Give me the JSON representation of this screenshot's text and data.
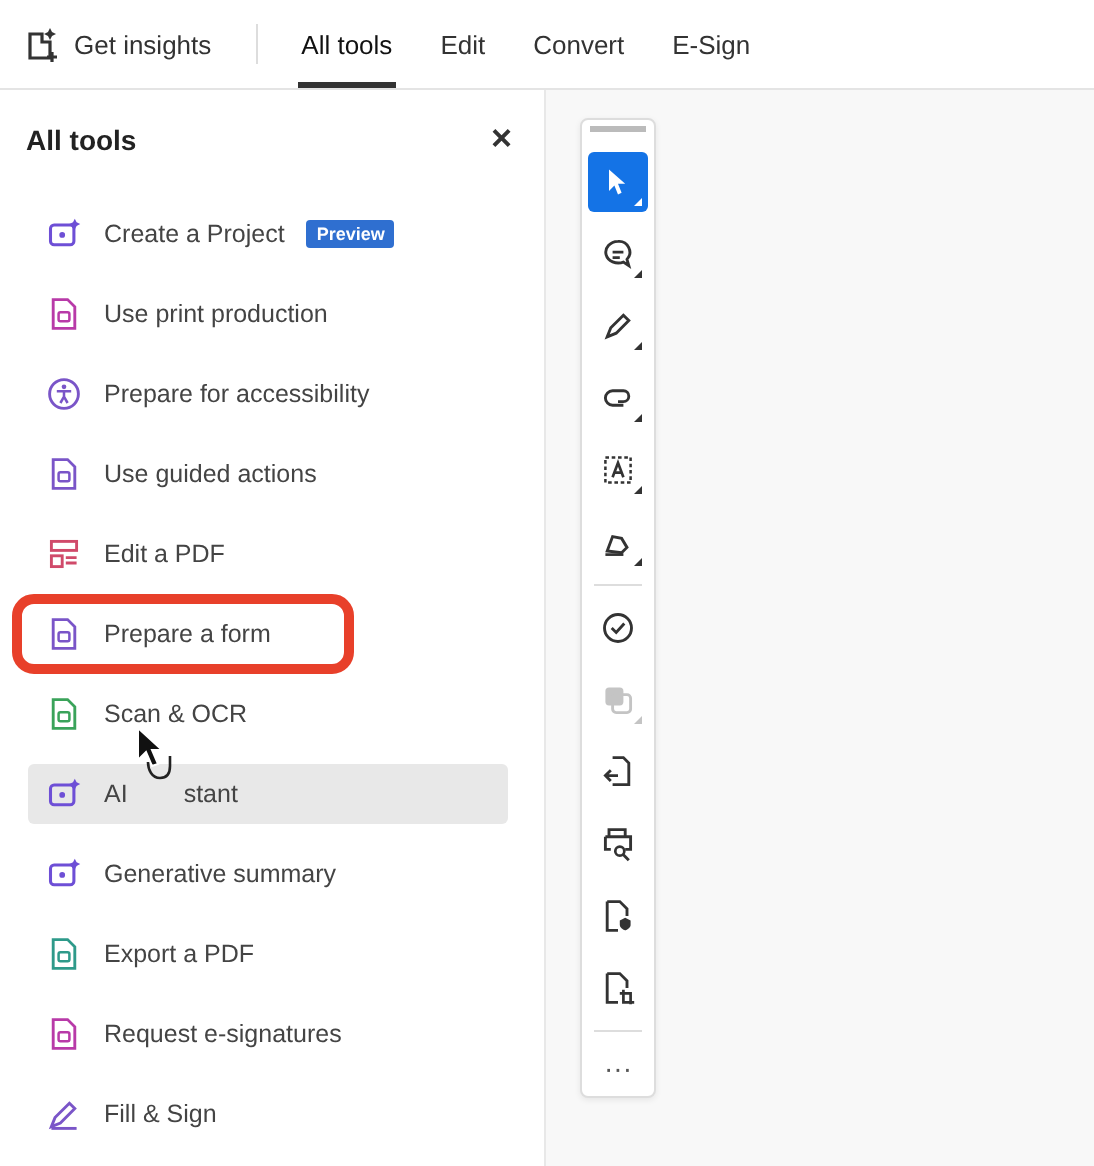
{
  "top_bar": {
    "insights": "Get insights",
    "tabs": [
      {
        "label": "All tools",
        "selected": true
      },
      {
        "label": "Edit",
        "selected": false
      },
      {
        "label": "Convert",
        "selected": false
      },
      {
        "label": "E-Sign",
        "selected": false
      }
    ]
  },
  "panel": {
    "title": "All tools",
    "close": "×",
    "items": [
      {
        "kind": "project",
        "label": "Create a Project",
        "badge": "Preview",
        "hovered": false,
        "highlighted": false
      },
      {
        "kind": "print",
        "label": "Use print production",
        "hovered": false,
        "highlighted": false
      },
      {
        "kind": "access",
        "label": "Prepare for accessibility",
        "hovered": false,
        "highlighted": false
      },
      {
        "kind": "guided",
        "label": "Use guided actions",
        "hovered": false,
        "highlighted": false
      },
      {
        "kind": "edit",
        "label": "Edit a PDF",
        "hovered": false,
        "highlighted": false
      },
      {
        "kind": "form",
        "label": "Prepare a form",
        "hovered": false,
        "highlighted": true
      },
      {
        "kind": "scan",
        "label": "Scan & OCR",
        "hovered": false,
        "highlighted": false
      },
      {
        "kind": "assistant",
        "label": "AI",
        "label_tail": "stant",
        "hovered": true,
        "highlighted": false
      },
      {
        "kind": "summary",
        "label": "Generative summary",
        "hovered": false,
        "highlighted": false
      },
      {
        "kind": "export",
        "label": "Export a PDF",
        "hovered": false,
        "highlighted": false
      },
      {
        "kind": "esign",
        "label": "Request e-signatures",
        "hovered": false,
        "highlighted": false
      },
      {
        "kind": "fill",
        "label": "Fill & Sign",
        "hovered": false,
        "highlighted": false
      }
    ]
  },
  "toolbar": {
    "tools": [
      {
        "kind": "select",
        "selected": true,
        "disabled": false
      },
      {
        "kind": "comment",
        "selected": false,
        "disabled": false
      },
      {
        "kind": "pen",
        "selected": false,
        "disabled": false
      },
      {
        "kind": "lasso",
        "selected": false,
        "disabled": false
      },
      {
        "kind": "textbox",
        "selected": false,
        "disabled": false
      },
      {
        "kind": "sign",
        "selected": false,
        "disabled": false
      },
      {
        "kind": "check",
        "selected": false,
        "disabled": false
      },
      {
        "kind": "copy",
        "selected": false,
        "disabled": true
      },
      {
        "kind": "insert",
        "selected": false,
        "disabled": false
      },
      {
        "kind": "printer",
        "selected": false,
        "disabled": false
      },
      {
        "kind": "protect",
        "selected": false,
        "disabled": false
      },
      {
        "kind": "crop",
        "selected": false,
        "disabled": false
      }
    ],
    "more": "···"
  }
}
